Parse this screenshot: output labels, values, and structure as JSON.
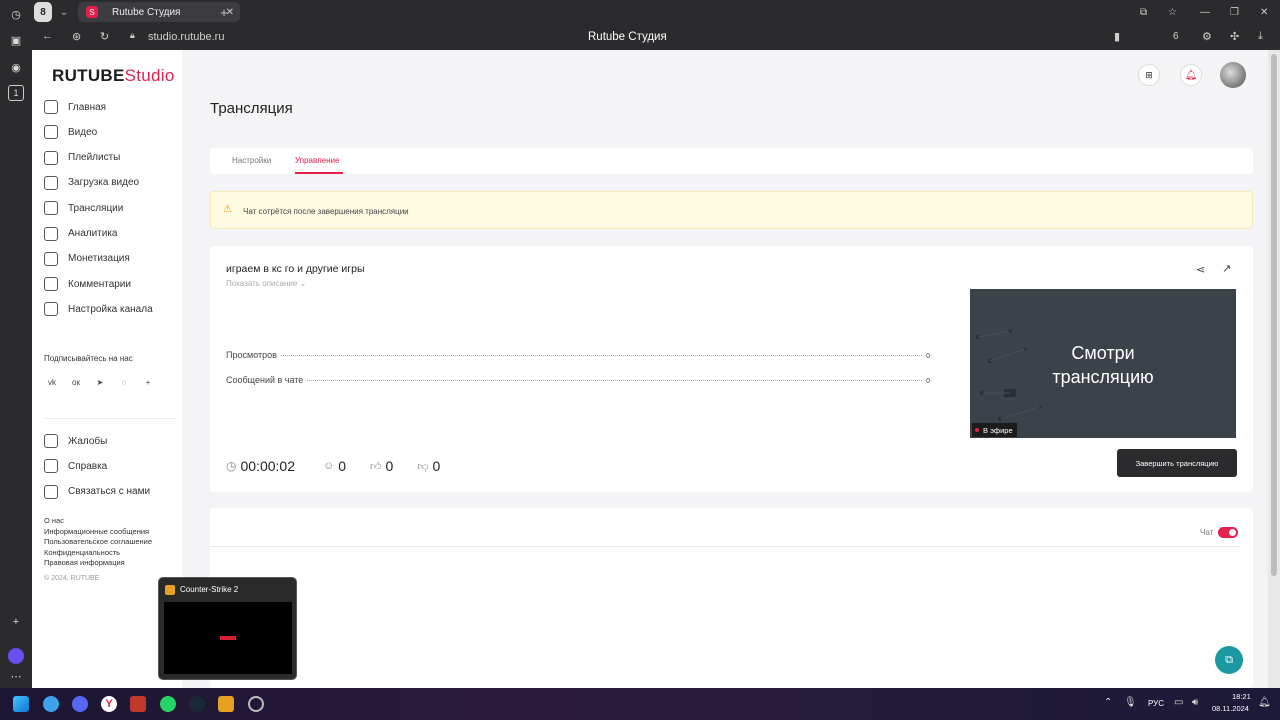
{
  "browser": {
    "tab_count_badge": "8",
    "tab_title": "Rutube Студия",
    "url": "studio.rutube.ru",
    "page_title": "Rutube Студия",
    "extra_count": "6"
  },
  "logo": {
    "main": "RUTUBE",
    "accent": "Studio",
    "accent_color": "#e6204c"
  },
  "sidebar": {
    "items": [
      {
        "label": "Главная",
        "icon": "home-icon"
      },
      {
        "label": "Видео",
        "icon": "video-icon"
      },
      {
        "label": "Плейлисты",
        "icon": "playlist-icon"
      },
      {
        "label": "Загрузка видео",
        "icon": "upload-icon"
      },
      {
        "label": "Трансляции",
        "icon": "broadcast-icon"
      },
      {
        "label": "Аналитика",
        "icon": "analytics-icon"
      },
      {
        "label": "Монетизация",
        "icon": "monetization-icon"
      },
      {
        "label": "Комментарии",
        "icon": "comments-icon"
      },
      {
        "label": "Настройка канала",
        "icon": "channel-settings-icon"
      }
    ],
    "subscribe_label": "Подписывайтесь на нас",
    "socials": [
      "vk-icon",
      "ok-icon",
      "telegram-icon",
      "viber-icon",
      "plus-icon"
    ],
    "bottom_items": [
      {
        "label": "Жалобы",
        "icon": "flag-icon"
      },
      {
        "label": "Справка",
        "icon": "help-icon"
      },
      {
        "label": "Связаться с нами",
        "icon": "contact-icon"
      }
    ],
    "footer_links": [
      "О нас",
      "Информационные сообщения",
      "Пользовательское соглашение",
      "Конфиденциальность",
      "Правовая информация"
    ],
    "copyright": "© 2024, RUTUBE"
  },
  "main": {
    "heading": "Трансляция",
    "tabs": [
      {
        "label": "Настройки"
      },
      {
        "label": "Управление",
        "active": true
      }
    ],
    "notice": "Чат сотрётся после завершения трансляции",
    "stream_title": "играем в кс го и другие игры",
    "show_description": "Показать описание",
    "stats": [
      {
        "label": "Просмотров",
        "value": "0"
      },
      {
        "label": "Сообщений в чате",
        "value": "0"
      }
    ],
    "timer": "00:00:02",
    "viewers": "0",
    "likes": "0",
    "dislikes": "0",
    "preview_text_line1": "Смотри",
    "preview_text_line2": "трансляцию",
    "live_badge": "В эфире",
    "end_button": "Завершить трансляцию",
    "chat_label": "Чат",
    "chat_enabled": true
  },
  "popup": {
    "title": "Counter-Strike 2"
  },
  "taskbar": {
    "lang": "РУС",
    "time": "18:21",
    "date": "08.11.2024"
  }
}
